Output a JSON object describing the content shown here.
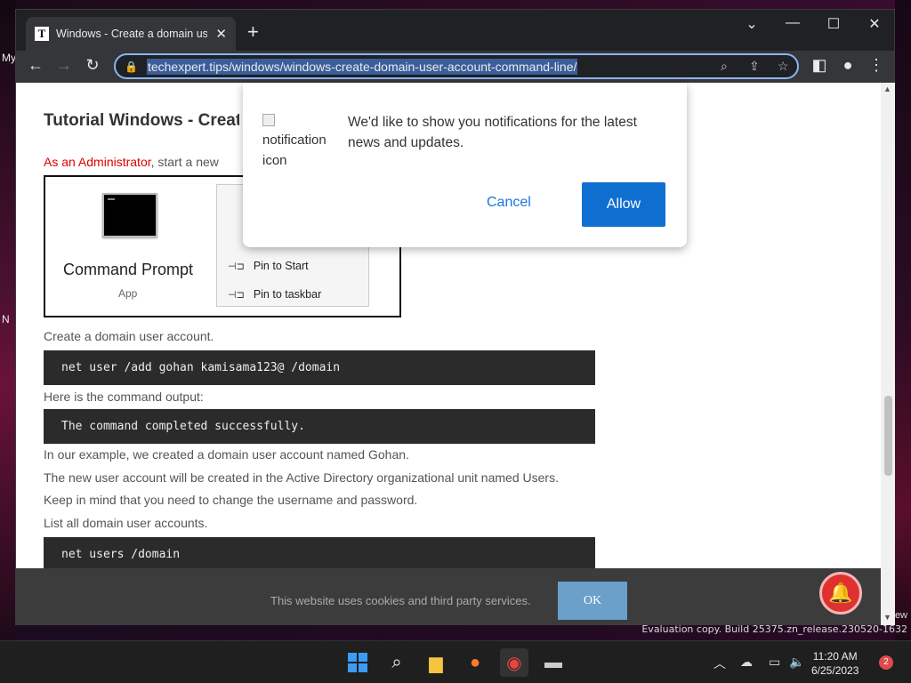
{
  "desktop": {
    "left_text_1": "My",
    "left_text_2": "N",
    "right_text": "ew",
    "watermark": "Evaluation copy. Build 25375.zn_release.230520-1632"
  },
  "browser": {
    "tab_title": "Windows - Create a domain user account",
    "tab_favicon": "T",
    "url": "techexpert.tips/windows/windows-create-domain-user-account-command-line/"
  },
  "article": {
    "heading": "Tutorial Windows - Create a domain user account using the command-line",
    "lead_admin": "As an Administrator",
    "lead_rest": ", start a new",
    "image": {
      "title": "Command Prompt",
      "subtitle": "App",
      "menu_items": [
        "Pin to Start",
        "Pin to taskbar"
      ]
    },
    "p1": "Create a domain user account.",
    "code1": "net user /add gohan kamisama123@ /domain",
    "p2": "Here is the command output:",
    "code2": "The command completed successfully.",
    "p3": "In our example, we created a domain user account named Gohan.",
    "p4": "The new user account will be created in the Active Directory organizational unit named Users.",
    "p5": "Keep in mind that you need to change the username and password.",
    "p6": "List all domain user accounts.",
    "code3": "net users /domain"
  },
  "notification_prompt": {
    "icon_alt": "notification icon",
    "message": "We'd like to show you notifications for the latest news and updates.",
    "cancel_label": "Cancel",
    "allow_label": "Allow"
  },
  "cookie_bar": {
    "text": "This website uses cookies and third party services.",
    "ok_label": "OK"
  },
  "taskbar": {
    "time": "11:20 AM",
    "date": "6/25/2023",
    "notification_count": "2"
  }
}
